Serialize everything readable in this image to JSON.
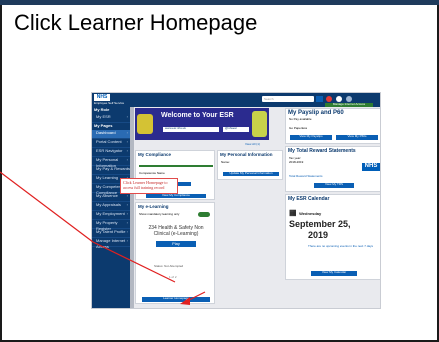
{
  "instruction": "Click Learner Homepage",
  "esr": {
    "logo": "NHS",
    "header_line": "Employee Self Service",
    "search_placeholder": "Search",
    "manage_label": "Manage Internet Access",
    "sidebar": {
      "section1": "My Role",
      "role": "My ESR",
      "section2": "My Pages",
      "items": [
        {
          "label": "Dashboard",
          "active": true
        },
        {
          "label": "Portal Content"
        },
        {
          "label": "ESR Navigator"
        },
        {
          "label": "My Personal Information"
        },
        {
          "label": "My Pay & Rewards"
        },
        {
          "label": "My Learning"
        },
        {
          "label": "My Competence & Compliance"
        },
        {
          "label": "My Absence"
        },
        {
          "label": "My Appraisals"
        },
        {
          "label": "My Employment"
        },
        {
          "label": "My Property Register"
        },
        {
          "label": "My Talent Profile"
        },
        {
          "label": "Manage Internet Access"
        }
      ]
    },
    "banner": {
      "title": "Welcome to Your ESR",
      "url": "www.esr.nhs.uk",
      "twitter": "@nhsesr",
      "view_all": "View All (1)"
    },
    "compliance": {
      "title": "My Compliance",
      "label": "Competence Name",
      "view": "View",
      "button": "View My Compliance"
    },
    "personal": {
      "title": "My Personal Information",
      "name_label": "Name:",
      "button": "Update My Personal Information"
    },
    "learning": {
      "title": "My e-Learning",
      "toggle_label": "Show mandatory learning only",
      "course": "234 Health & Safety Non Clinical (e-Learning)",
      "play": "Play",
      "status": "Status: Not Attempted",
      "pager": "1 of 2",
      "button": "Learner Homepage"
    },
    "payslip": {
      "title": "My Payslip and P60",
      "sub": "No Pay available",
      "paperless": "Go Paperless",
      "btn1": "View My Payslips",
      "btn2": "View My P60s"
    },
    "reward": {
      "title": "My Total Reward Statements",
      "tax_year": "Tax year:",
      "year": "2018-2019",
      "link": "Total Reward Statements",
      "button": "View My TRS"
    },
    "calendar": {
      "title": "My ESR Calendar",
      "day": "Wednesday",
      "date": "September 25,",
      "year": "2019",
      "info": "There are no upcoming events in the next 7 days",
      "button": "View My Calendar"
    }
  },
  "callout": "Click Learner Homepage to access full training record",
  "colors": {
    "arrow": "#e02020",
    "header": "#0c3a6e",
    "accent": "#0a5fb4"
  }
}
